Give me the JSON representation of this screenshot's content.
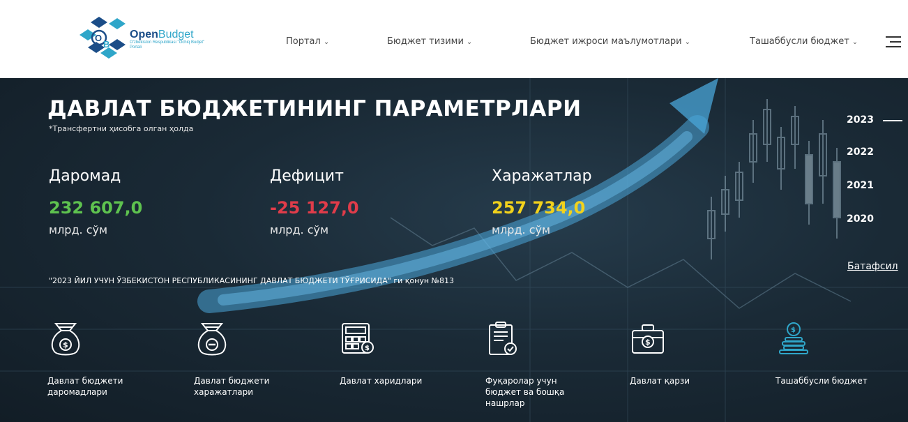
{
  "header": {
    "logo": {
      "brand_bold": "Open",
      "brand_light": "Budget",
      "tagline": "O'zbekiston Respublikasi \"Ochiq Budjet\" Portali"
    },
    "nav": [
      {
        "label": "Портал"
      },
      {
        "label": "Бюджет тизими"
      },
      {
        "label": "Бюджет ижроси маълумотлари"
      },
      {
        "label": "Ташаббусли бюджет"
      }
    ],
    "chevron": "⌄"
  },
  "hero": {
    "title": "ДАВЛАТ БЮДЖЕТИНИНГ ПАРАМЕТРЛАРИ",
    "subnote": "*Трансфертни ҳисобга олган ҳолда",
    "metrics": [
      {
        "label": "Даромад",
        "value": "232 607,0",
        "unit": "млрд. сўм",
        "color": "#5ec24f"
      },
      {
        "label": "Дефицит",
        "value": "-25 127,0",
        "unit": "млрд. сўм",
        "color": "#e03c4a"
      },
      {
        "label": "Харажатлар",
        "value": "257 734,0",
        "unit": "млрд. сўм",
        "color": "#f2d21c"
      }
    ],
    "law": "\"2023 ЙИЛ УЧУН ЎЗБЕКИСТОН РЕСПУБЛИКАСИНИНГ ДАВЛАТ БЮДЖЕТИ ТЎҒРИСИДА\" ги қонун №813",
    "years": [
      "2023",
      "2022",
      "2021",
      "2020"
    ],
    "selected_year": "2023",
    "more_link": "Батафсил"
  },
  "cards": [
    {
      "icon": "money-bag-plus-icon",
      "label": "Давлат бюджети даромадлари"
    },
    {
      "icon": "money-bag-minus-icon",
      "label": "Давлат бюджети харажатлари"
    },
    {
      "icon": "calculator-icon",
      "label": "Давлат харидлари"
    },
    {
      "icon": "clipboard-check-icon",
      "label": "Фуқаролар учун бюджет ва бошқа нашрлар"
    },
    {
      "icon": "briefcase-dollar-icon",
      "label": "Давлат қарзи"
    },
    {
      "icon": "coin-stack-icon",
      "label": "Ташаббусли бюджет"
    }
  ],
  "colors": {
    "accent_teal": "#2fa6c9",
    "brand_blue": "#1b4d88",
    "hero_bg": "#1a2a36"
  }
}
